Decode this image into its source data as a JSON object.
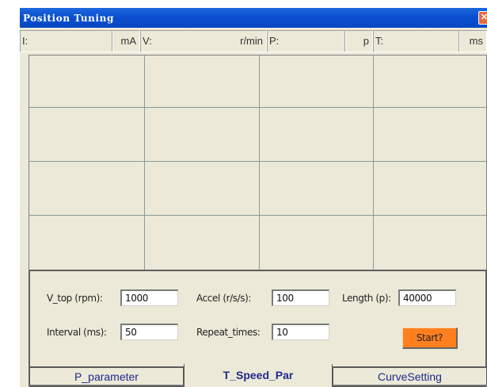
{
  "window": {
    "title": "Position Tuning",
    "close_glyph": "✕"
  },
  "readouts": [
    {
      "label": "I:",
      "unit": "mA"
    },
    {
      "label": "V:",
      "unit": "r/min"
    },
    {
      "label": "P:",
      "unit": "p"
    },
    {
      "label": "T:",
      "unit": "ms"
    }
  ],
  "params": {
    "v_top": {
      "label": "V_top (rpm):",
      "value": "1000"
    },
    "accel": {
      "label": "Accel (r/s/s):",
      "value": "100"
    },
    "length": {
      "label": "Length (p):",
      "value": "40000"
    },
    "interval": {
      "label": "Interval (ms):",
      "value": "50"
    },
    "repeat": {
      "label": "Repeat_times:",
      "value": "10"
    },
    "start_label": "Start?"
  },
  "tabs": [
    {
      "label": "P_parameter",
      "active": false
    },
    {
      "label": "T_Speed_Par",
      "active": true
    },
    {
      "label": "CurveSetting",
      "active": false
    }
  ],
  "colors": {
    "title_bar": "#0a4fcf",
    "start_button": "#ff7f1e",
    "tab_text": "#1f2a8c"
  }
}
